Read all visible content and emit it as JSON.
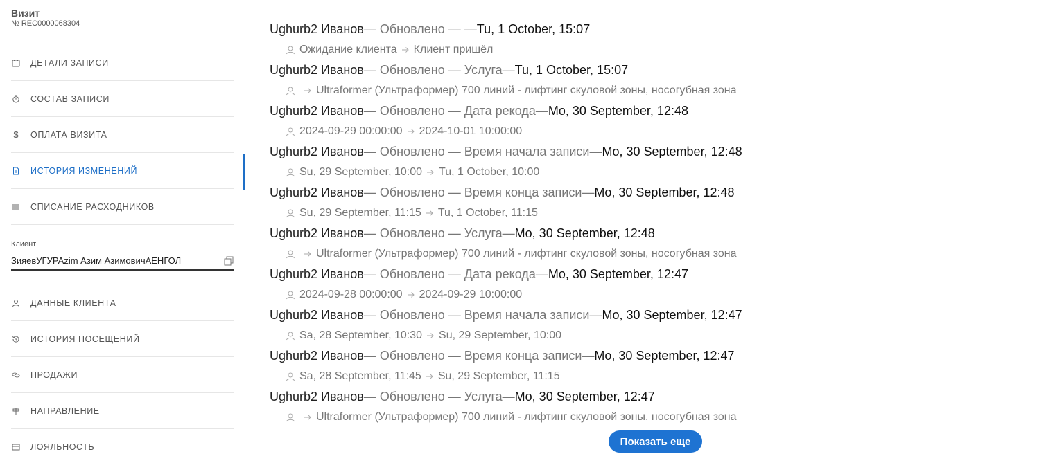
{
  "header": {
    "title": "Визит",
    "number": "№ REC0000068304"
  },
  "nav": {
    "details": "ДЕТАЛИ ЗАПИСИ",
    "composition": "СОСТАВ ЗАПИСИ",
    "payment": "ОПЛАТА ВИЗИТА",
    "history": "ИСТОРИЯ ИЗМЕНЕНИЙ",
    "consumables": "СПИСАНИЕ РАСХОДНИКОВ",
    "client_data": "ДАННЫЕ КЛИЕНТА",
    "visits_history": "ИСТОРИЯ ПОСЕЩЕНИЙ",
    "sales": "ПРОДАЖИ",
    "direction": "НАПРАВЛЕНИЕ",
    "loyalty": "ЛОЯЛЬНОСТЬ"
  },
  "client": {
    "label": "Клиент",
    "value": "ЗияевУГУРАzim Азим АзимовичАЕНГОЛ"
  },
  "history": [
    {
      "user": "Ughurb2 Иванов",
      "meta": "— Обновлено — —",
      "date": "Tu, 1 October, 15:07",
      "from": "Ожидание клиента",
      "to": "Клиент пришёл"
    },
    {
      "user": "Ughurb2 Иванов",
      "meta": "— Обновлено — Услуга—",
      "date": "Tu, 1 October, 15:07",
      "from": "",
      "to": "Ultraformer (Ультраформер) 700 линий - лифтинг скуловой зоны, носогубная зона"
    },
    {
      "user": "Ughurb2 Иванов",
      "meta": "— Обновлено — Дата рекода—",
      "date": "Mo, 30 September, 12:48",
      "from": "2024-09-29 00:00:00",
      "to": "2024-10-01 10:00:00"
    },
    {
      "user": "Ughurb2 Иванов",
      "meta": "— Обновлено — Время начала записи—",
      "date": "Mo, 30 September, 12:48",
      "from": "Su, 29 September, 10:00",
      "to": "Tu, 1 October, 10:00"
    },
    {
      "user": "Ughurb2 Иванов",
      "meta": "— Обновлено — Время конца записи—",
      "date": "Mo, 30 September, 12:48",
      "from": "Su, 29 September, 11:15",
      "to": "Tu, 1 October, 11:15"
    },
    {
      "user": "Ughurb2 Иванов",
      "meta": "— Обновлено — Услуга—",
      "date": "Mo, 30 September, 12:48",
      "from": "",
      "to": "Ultraformer (Ультраформер) 700 линий - лифтинг скуловой зоны, носогубная зона"
    },
    {
      "user": "Ughurb2 Иванов",
      "meta": "— Обновлено — Дата рекода—",
      "date": "Mo, 30 September, 12:47",
      "from": "2024-09-28 00:00:00",
      "to": "2024-09-29 10:00:00"
    },
    {
      "user": "Ughurb2 Иванов",
      "meta": "— Обновлено — Время начала записи—",
      "date": "Mo, 30 September, 12:47",
      "from": "Sa, 28 September, 10:30",
      "to": "Su, 29 September, 10:00"
    },
    {
      "user": "Ughurb2 Иванов",
      "meta": "— Обновлено — Время конца записи—",
      "date": "Mo, 30 September, 12:47",
      "from": "Sa, 28 September, 11:45",
      "to": "Su, 29 September, 11:15"
    },
    {
      "user": "Ughurb2 Иванов",
      "meta": "— Обновлено — Услуга—",
      "date": "Mo, 30 September, 12:47",
      "from": "",
      "to": "Ultraformer (Ультраформер) 700 линий - лифтинг скуловой зоны, носогубная зона"
    }
  ],
  "more_button": "Показать еще",
  "colors": {
    "accent": "#1e6fc7",
    "button": "#1e73d2"
  }
}
